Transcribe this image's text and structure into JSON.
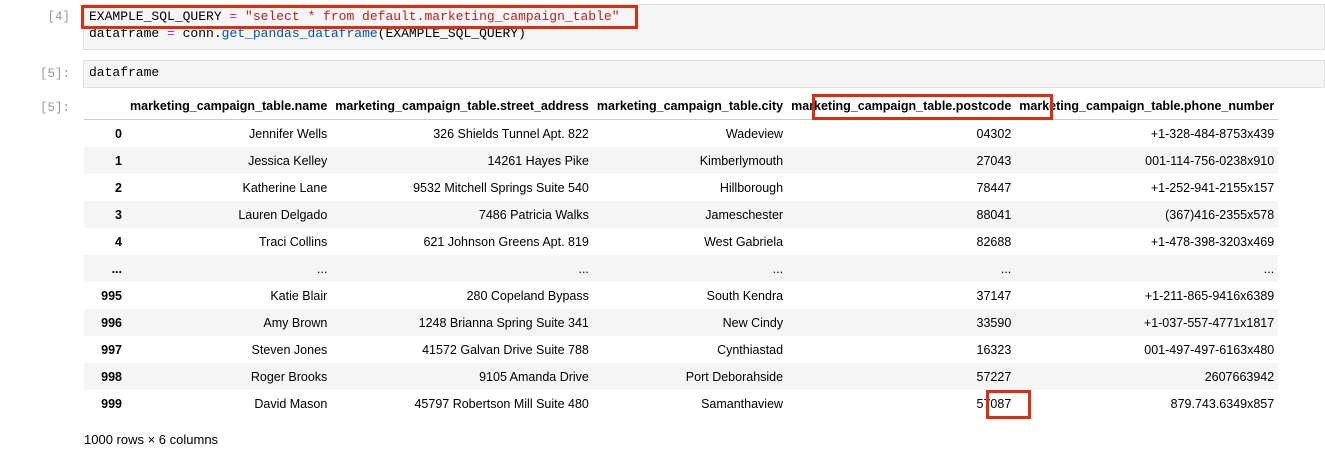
{
  "cells": [
    {
      "prompt": "[4]",
      "lines": [
        {
          "var": "EXAMPLE_SQL_QUERY",
          "op": " = ",
          "str": "\"select * from default.marketing_campaign_table\""
        },
        {
          "var": "dataframe",
          "op": " = ",
          "pre": "conn.",
          "fn": "get_pandas_dataframe",
          "post": "(EXAMPLE_SQL_QUERY)"
        }
      ]
    },
    {
      "prompt": "[5]:",
      "code": "dataframe"
    }
  ],
  "output_prompt": "[5]:",
  "table": {
    "columns": [
      "",
      "marketing_campaign_table.name",
      "marketing_campaign_table.street_address",
      "marketing_campaign_table.city",
      "marketing_campaign_table.postcode",
      "marketing_campaign_table.phone_number"
    ],
    "rows": [
      [
        "0",
        "Jennifer Wells",
        "326 Shields Tunnel Apt. 822",
        "Wadeview",
        "04302",
        "+1-328-484-8753x439"
      ],
      [
        "1",
        "Jessica Kelley",
        "14261 Hayes Pike",
        "Kimberlymouth",
        "27043",
        "001-114-756-0238x910"
      ],
      [
        "2",
        "Katherine Lane",
        "9532 Mitchell Springs Suite 540",
        "Hillborough",
        "78447",
        "+1-252-941-2155x157"
      ],
      [
        "3",
        "Lauren Delgado",
        "7486 Patricia Walks",
        "Jameschester",
        "88041",
        "(367)416-2355x578"
      ],
      [
        "4",
        "Traci Collins",
        "621 Johnson Greens Apt. 819",
        "West Gabriela",
        "82688",
        "+1-478-398-3203x469"
      ],
      [
        "...",
        "...",
        "...",
        "...",
        "...",
        "..."
      ],
      [
        "995",
        "Katie Blair",
        "280 Copeland Bypass",
        "South Kendra",
        "37147",
        "+1-211-865-9416x6389"
      ],
      [
        "996",
        "Amy Brown",
        "1248 Brianna Spring Suite 341",
        "New Cindy",
        "33590",
        "+1-037-557-4771x1817"
      ],
      [
        "997",
        "Steven Jones",
        "41572 Galvan Drive Suite 788",
        "Cynthiastad",
        "16323",
        "001-497-497-6163x480"
      ],
      [
        "998",
        "Roger Brooks",
        "9105 Amanda Drive",
        "Port Deborahside",
        "57227",
        "2607663942"
      ],
      [
        "999",
        "David Mason",
        "45797 Robertson Mill Suite 480",
        "Samanthaview",
        "57087",
        "879.743.6349x857"
      ]
    ]
  },
  "footer": "1000 rows × 6 columns",
  "colors": {
    "highlight": "#d62f12",
    "string": "#ba2121",
    "operator": "#aa22ff",
    "function": "#0055aa"
  }
}
